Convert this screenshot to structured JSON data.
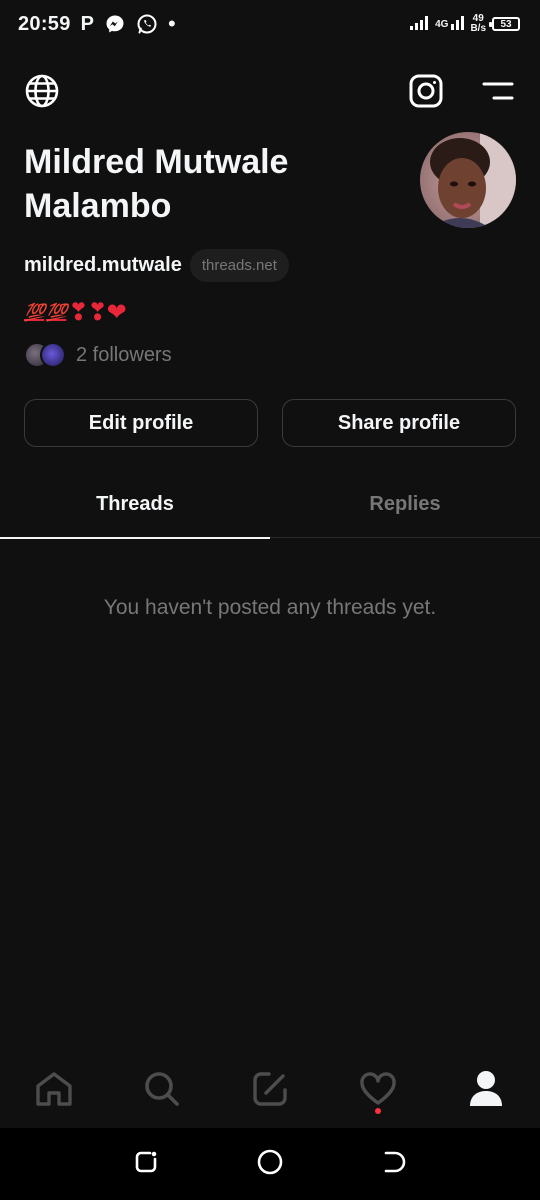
{
  "status_bar": {
    "time": "20:59",
    "app_p": "P",
    "net_type": "4G",
    "net_speed_value": "49",
    "net_speed_unit": "B/s",
    "battery": "53"
  },
  "profile": {
    "name": "Mildred Mutwale Malambo",
    "handle": "mildred.mutwale",
    "domain": "threads.net",
    "bio_hundred_1": "💯",
    "bio_hundred_2": "💯",
    "bio_hearts": "❣❣❤",
    "followers": "2 followers"
  },
  "buttons": {
    "edit": "Edit profile",
    "share": "Share profile"
  },
  "tabs": [
    {
      "label": "Threads",
      "active": true
    },
    {
      "label": "Replies",
      "active": false
    }
  ],
  "empty_state": "You haven't posted any threads yet.",
  "bottom_nav": [
    {
      "icon": "home-icon"
    },
    {
      "icon": "search-icon"
    },
    {
      "icon": "compose-icon"
    },
    {
      "icon": "heart-icon"
    },
    {
      "icon": "profile-icon"
    }
  ],
  "colors": {
    "background": "#101010",
    "text_primary": "#f3f5f7",
    "text_secondary": "#777777",
    "notification_dot": "#ff3040"
  }
}
